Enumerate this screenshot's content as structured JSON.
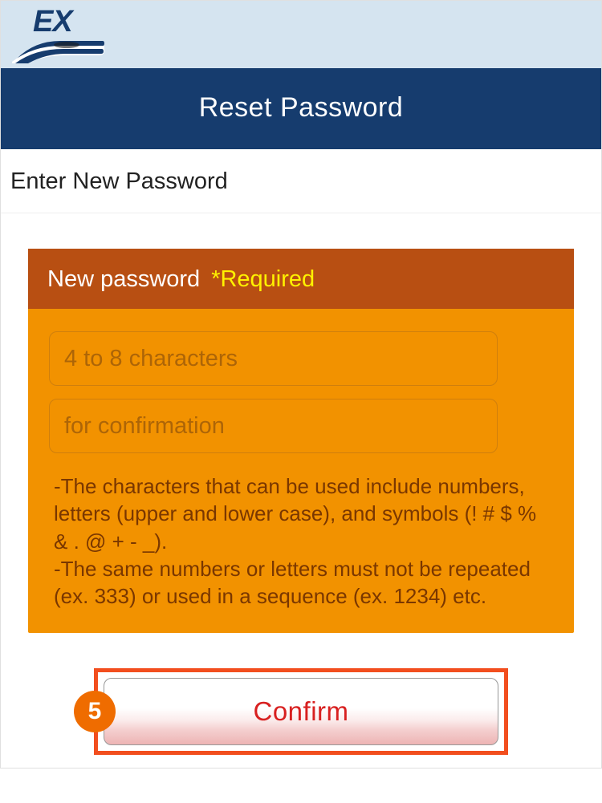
{
  "header": {
    "logo_label": "EX"
  },
  "title": "Reset Password",
  "instruction": "Enter New Password",
  "form": {
    "section_label": "New password",
    "required_label": "*Required",
    "password_placeholder": "4 to 8 characters",
    "confirm_placeholder": "for confirmation",
    "rules_text": "-The characters that can be used include numbers, letters (upper and lower case), and symbols (! # $ % & . @ + - _).\n-The same numbers or letters must not be repeated (ex. 333) or used in a sequence (ex. 1234) etc."
  },
  "confirm_button_label": "Confirm",
  "step_number": "5",
  "colors": {
    "brand_blue": "#163c6e",
    "brand_orange": "#f29200",
    "brand_orange_dark": "#b84f12",
    "highlight": "#f24e1e",
    "badge": "#ef6c00",
    "button_text": "#d82020"
  }
}
